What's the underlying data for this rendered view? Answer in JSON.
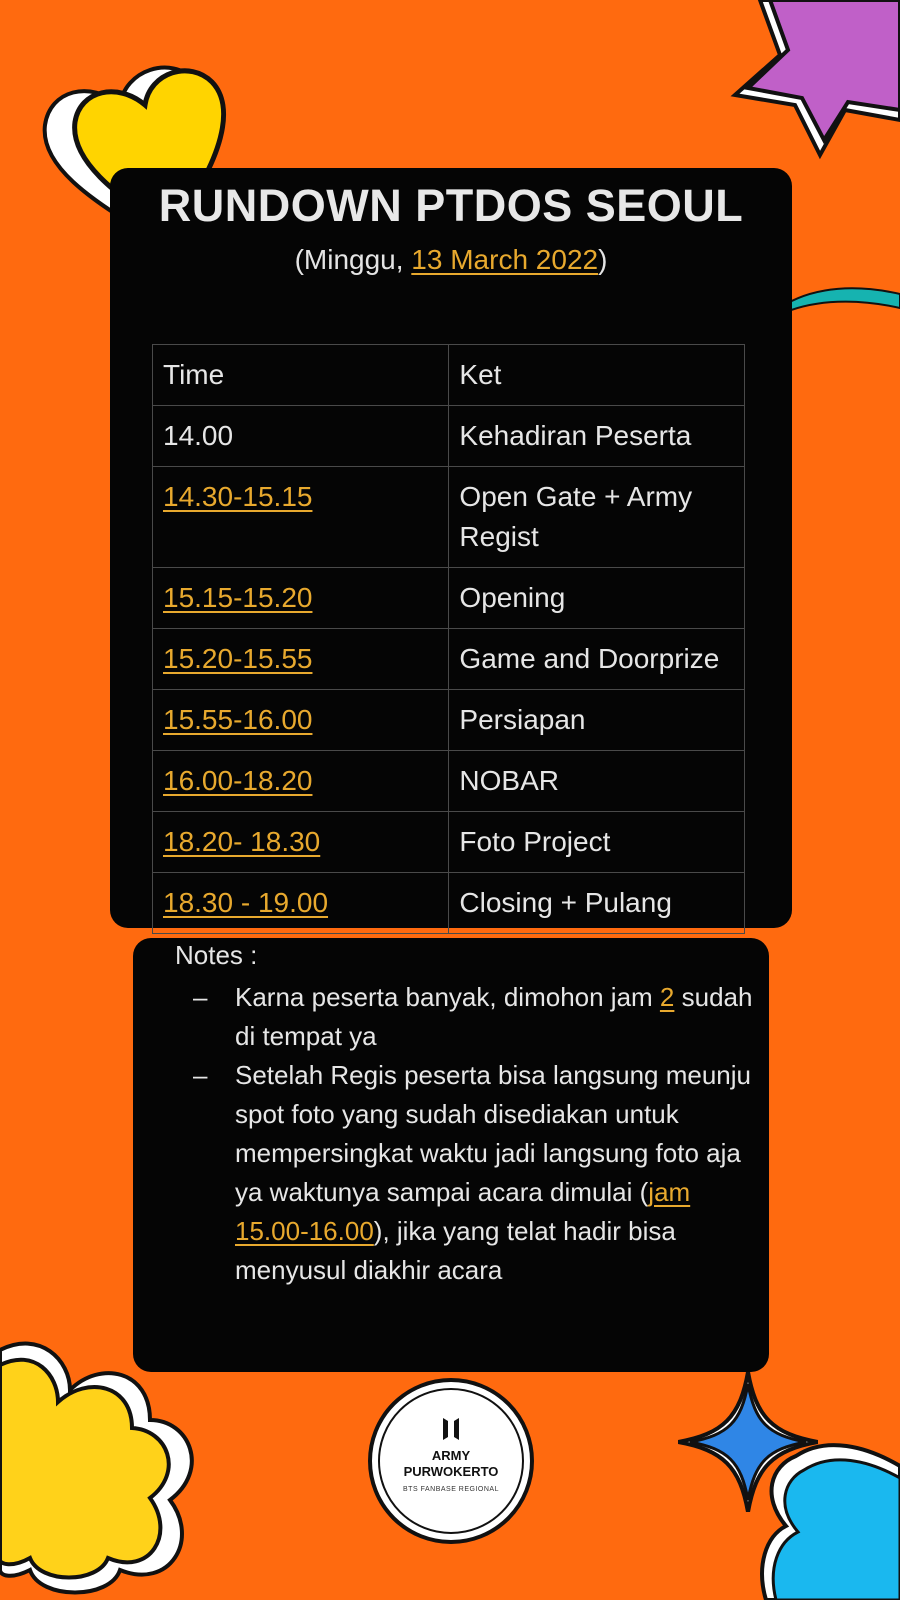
{
  "header": {
    "title": "RUNDOWN PTDOS SEOUL",
    "subtitle_prefix": "(Minggu, ",
    "subtitle_date": "13 March 2022",
    "subtitle_suffix": ")"
  },
  "schedule": {
    "columns": [
      "Time",
      "Ket"
    ],
    "rows": [
      {
        "time": "14.00",
        "ket": "Kehadiran Peserta",
        "time_linked": false
      },
      {
        "time": "14.30-15.15",
        "ket": "Open Gate + Army Regist",
        "time_linked": true
      },
      {
        "time": "15.15-15.20",
        "ket": "Opening",
        "time_linked": true
      },
      {
        "time": "15.20-15.55",
        "ket": "Game and Doorprize",
        "time_linked": true
      },
      {
        "time": "15.55-16.00",
        "ket": "Persiapan",
        "time_linked": true
      },
      {
        "time": "16.00-18.20",
        "ket": "NOBAR",
        "time_linked": true
      },
      {
        "time": "18.20- 18.30",
        "ket": "Foto Project",
        "time_linked": true
      },
      {
        "time": "18.30 - 19.00",
        "ket": "Closing + Pulang",
        "time_linked": true
      }
    ]
  },
  "notes": {
    "label": "Notes :",
    "bullet": "–",
    "item1": {
      "before": "Karna peserta banyak, dimohon jam ",
      "link": "2",
      "after": " sudah di tempat ya"
    },
    "item2": {
      "before": "Setelah Regis peserta bisa langsung meunju spot foto yang sudah disediakan untuk mempersingkat waktu jadi langsung foto aja ya waktunya sampai acara dimulai (",
      "link": "jam 15.00-16.00",
      "after": "), jika yang telat hadir bisa menyusul diakhir acara"
    }
  },
  "logo": {
    "line1": "ARMY",
    "line2": "PURWOKERTO",
    "line3": "BTS FANBASE REGIONAL"
  },
  "colors": {
    "background": "#ff6a0f",
    "card": "#050505",
    "link": "#e8a92e",
    "text": "#e6e6e6"
  }
}
